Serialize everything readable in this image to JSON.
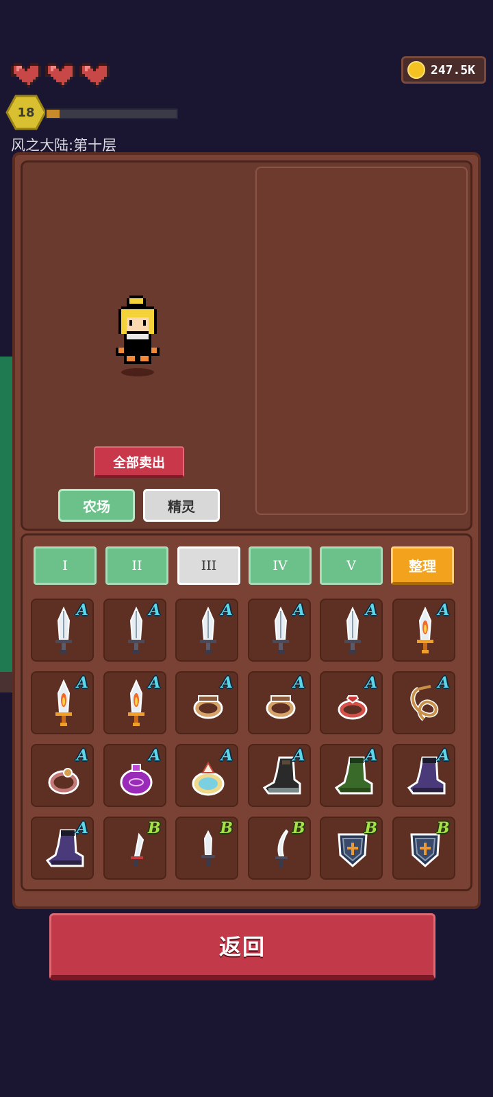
{
  "hud": {
    "hearts": 3,
    "coins": "247.5K",
    "level": "18",
    "xp_fraction": 0.1,
    "location": "风之大陆:第十层"
  },
  "panel": {
    "sell_all_label": "全部卖出",
    "tabs": [
      {
        "label": "农场",
        "state": "active"
      },
      {
        "label": "精灵",
        "state": "inactive"
      }
    ],
    "pages": [
      {
        "label": "I",
        "selected": false
      },
      {
        "label": "II",
        "selected": false
      },
      {
        "label": "III",
        "selected": true
      },
      {
        "label": "IV",
        "selected": false
      },
      {
        "label": "V",
        "selected": false
      }
    ],
    "sort_label": "整理"
  },
  "inventory": [
    {
      "item": "sword-icon",
      "grade": "A"
    },
    {
      "item": "sword-icon",
      "grade": "A"
    },
    {
      "item": "sword-icon",
      "grade": "A"
    },
    {
      "item": "sword-icon",
      "grade": "A"
    },
    {
      "item": "sword-icon",
      "grade": "A"
    },
    {
      "item": "fire-sword-icon",
      "grade": "A"
    },
    {
      "item": "fire-sword-icon",
      "grade": "A"
    },
    {
      "item": "fire-sword-icon",
      "grade": "A"
    },
    {
      "item": "ring-icon",
      "grade": "A"
    },
    {
      "item": "ring-icon",
      "grade": "A"
    },
    {
      "item": "red-ring-icon",
      "grade": "A"
    },
    {
      "item": "rope-necklace-icon",
      "grade": "A"
    },
    {
      "item": "pink-ring-icon",
      "grade": "A"
    },
    {
      "item": "purple-amulet-icon",
      "grade": "A"
    },
    {
      "item": "jewel-ring-icon",
      "grade": "A"
    },
    {
      "item": "dark-boots-icon",
      "grade": "A"
    },
    {
      "item": "green-boots-icon",
      "grade": "A"
    },
    {
      "item": "purple-boots-icon",
      "grade": "A"
    },
    {
      "item": "purple-boots-icon",
      "grade": "A"
    },
    {
      "item": "dagger-icon",
      "grade": "B"
    },
    {
      "item": "short-sword-icon",
      "grade": "B"
    },
    {
      "item": "curved-blade-icon",
      "grade": "B"
    },
    {
      "item": "shield-icon",
      "grade": "B"
    },
    {
      "item": "shield-icon",
      "grade": "B"
    }
  ],
  "footer": {
    "back_label": "返回"
  },
  "colors": {
    "background": "#1a1530",
    "panel": "#7a4234",
    "accent_red": "#c23a4a",
    "accent_green": "#6cc08a",
    "accent_orange": "#f2a21c",
    "grade_a": "#5ed6e8",
    "grade_b": "#a8e04a"
  }
}
